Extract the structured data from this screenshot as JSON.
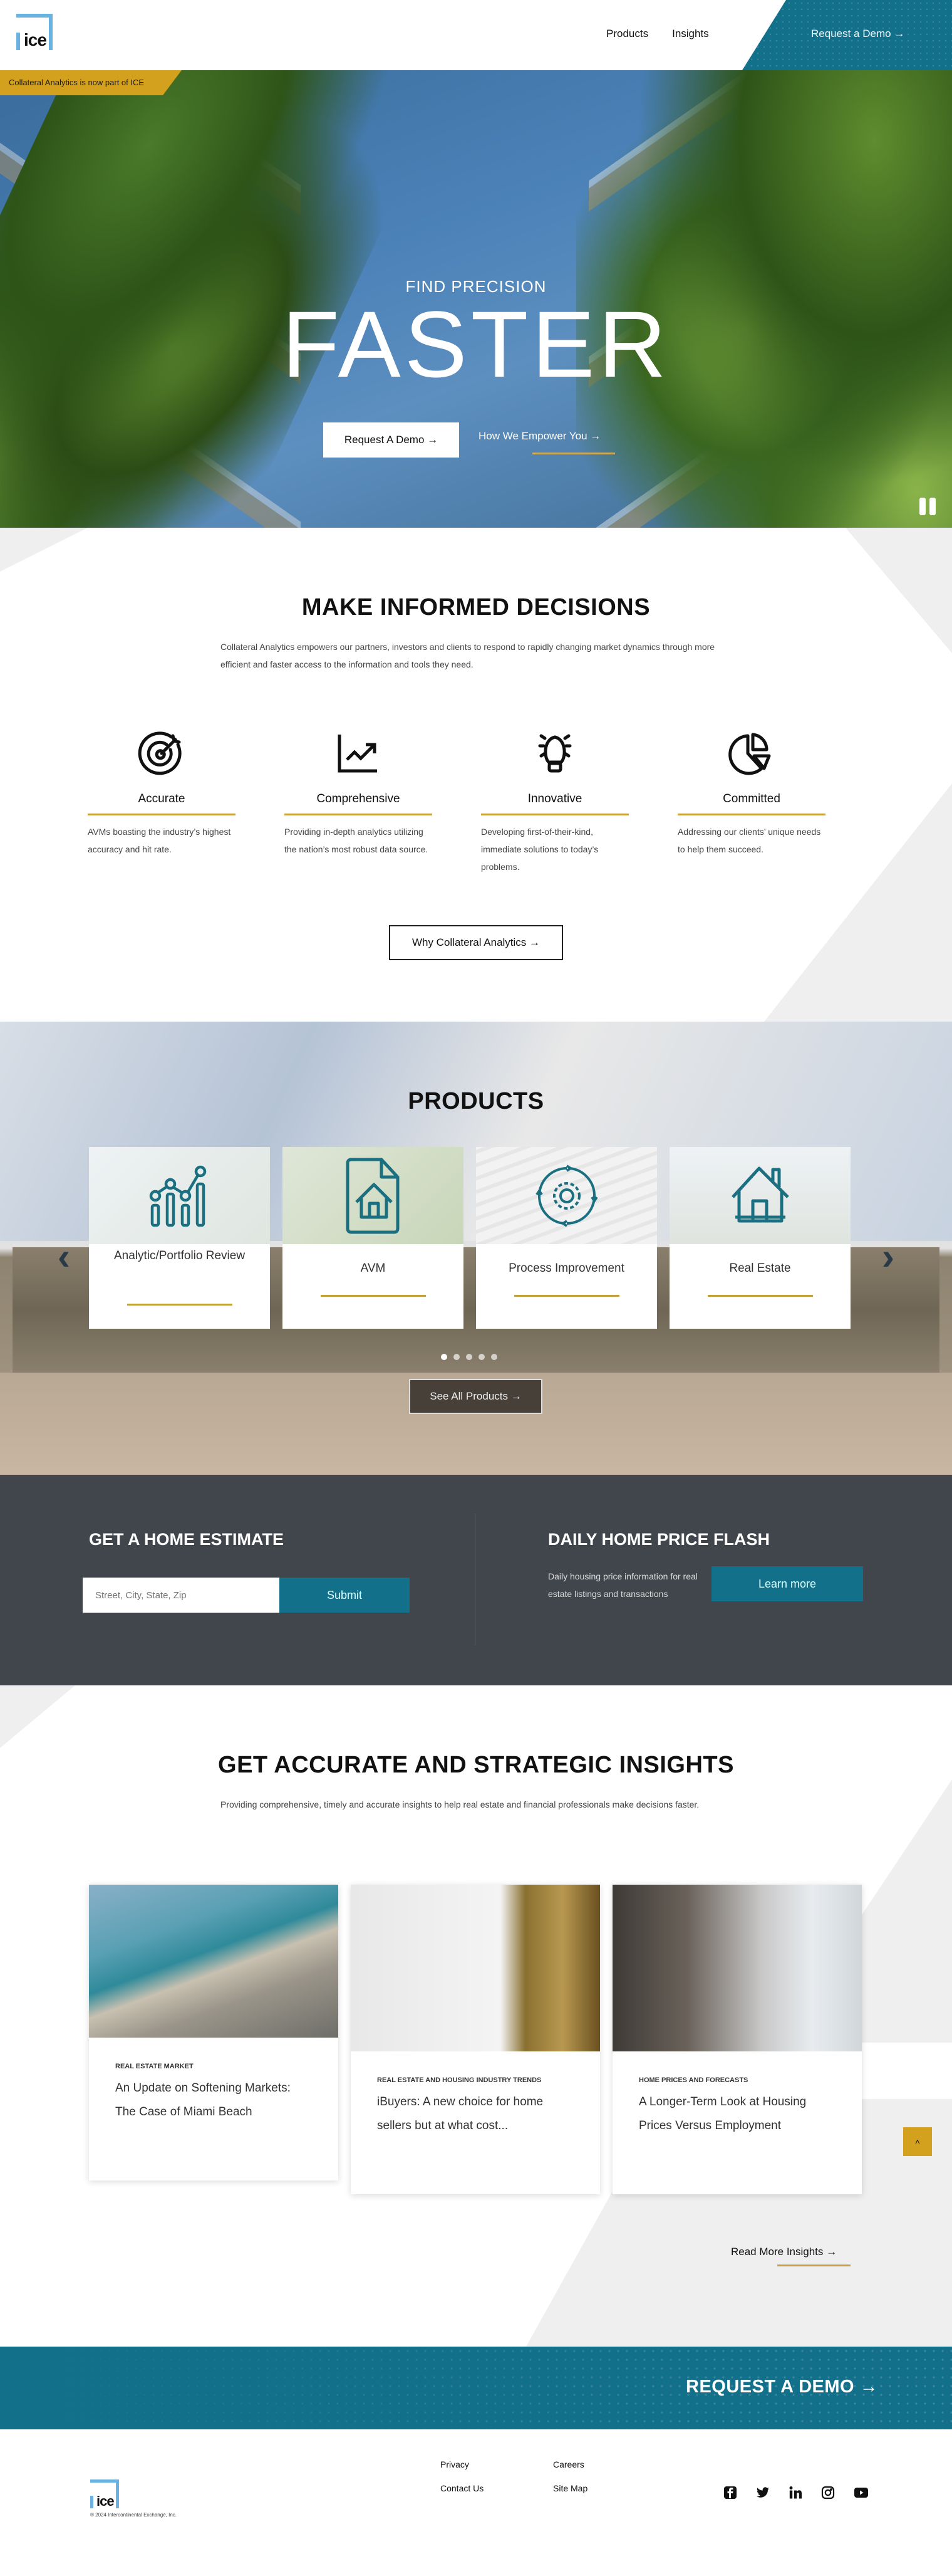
{
  "header": {
    "logo_text": "ice",
    "nav": [
      "Products",
      "Insights"
    ],
    "demo_link": "Request a Demo →"
  },
  "hero": {
    "banner": "Collateral Analytics is now part of ICE",
    "subtitle": "FIND PRECISION",
    "title": "FASTER",
    "primary_button": "Request A Demo →",
    "secondary_link": "How We Empower You →",
    "pause_icon": "pause-icon"
  },
  "decisions": {
    "title": "MAKE INFORMED DECISIONS",
    "intro": "Collateral Analytics empowers our partners, investors and clients to respond to rapidly changing market dynamics through more efficient and faster access to the information and tools they need.",
    "features": [
      {
        "icon": "target-icon",
        "title": "Accurate",
        "text": "AVMs boasting the industry’s highest accuracy and hit rate."
      },
      {
        "icon": "trend-chart-icon",
        "title": "Comprehensive",
        "text": "Providing in-depth analytics utilizing the nation’s most robust data source."
      },
      {
        "icon": "lightbulb-icon",
        "title": "Innovative",
        "text": "Developing first-of-their-kind, immediate solutions to today’s problems."
      },
      {
        "icon": "pie-chart-icon",
        "title": "Committed",
        "text": "Addressing our clients’ unique needs to help them succeed."
      }
    ],
    "button": "Why Collateral Analytics →"
  },
  "products": {
    "title": "PRODUCTS",
    "cards": [
      {
        "icon": "analytics-chart-icon",
        "label": "Analytic/Portfolio Review"
      },
      {
        "icon": "house-document-icon",
        "label": "AVM"
      },
      {
        "icon": "gear-cycle-icon",
        "label": "Process Improvement"
      },
      {
        "icon": "house-icon",
        "label": "Real Estate"
      }
    ],
    "carousel_pages": 5,
    "carousel_active": 1,
    "button": "See All Products →"
  },
  "estimate": {
    "title": "GET A HOME ESTIMATE",
    "input_placeholder": "Street, City, State, Zip",
    "submit": "Submit",
    "flash_title": "DAILY HOME PRICE FLASH",
    "flash_text": "Daily housing price information for real estate listings and transactions",
    "flash_button": "Learn more"
  },
  "insights": {
    "title": "GET ACCURATE AND STRATEGIC INSIGHTS",
    "intro": "Providing comprehensive, timely and accurate insights to help real estate and financial professionals make decisions faster.",
    "cards": [
      {
        "category": "REAL ESTATE MARKET",
        "title": "An Update on Softening Markets: The Case of Miami Beach"
      },
      {
        "category": "REAL ESTATE AND HOUSING INDUSTRY TRENDS",
        "title": "iBuyers: A new choice for home sellers but at what cost..."
      },
      {
        "category": "HOME PRICES AND FORECASTS",
        "title": "A Longer-Term Look at Housing Prices Versus Employment"
      }
    ],
    "read_more": "Read More Insights →",
    "back_to_top": "˄"
  },
  "cta": {
    "label": "REQUEST A DEMO →"
  },
  "footer": {
    "logo_text": "ice",
    "copyright": "® 2024 Intercontinental Exchange, Inc.",
    "links_col1": [
      "Privacy",
      "Contact Us"
    ],
    "links_col2": [
      "Careers",
      "Site Map"
    ],
    "social": [
      "facebook-icon",
      "twitter-icon",
      "linkedin-icon",
      "instagram-icon",
      "youtube-icon"
    ]
  },
  "colors": {
    "teal": "#12708a",
    "gold": "#d3a11e",
    "dark": "#40464b",
    "logo_blue": "#6ab3e0"
  }
}
